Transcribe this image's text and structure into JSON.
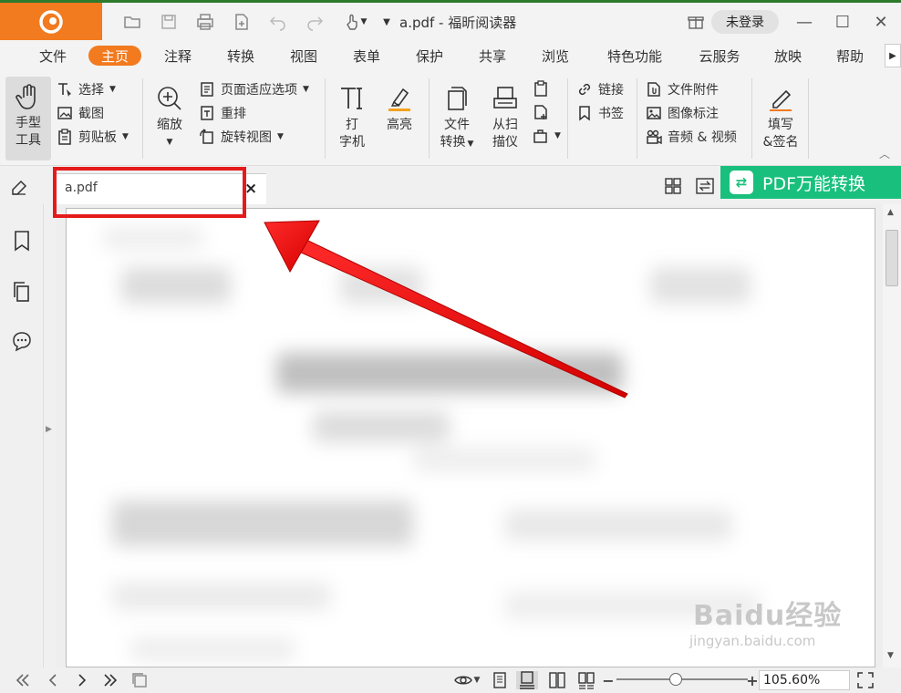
{
  "window": {
    "title": "a.pdf - 福昕阅读器",
    "login_label": "未登录"
  },
  "menu": {
    "items": [
      "文件",
      "主页",
      "注释",
      "转换",
      "视图",
      "表单",
      "保护",
      "共享",
      "浏览",
      "特色功能",
      "云服务",
      "放映",
      "帮助"
    ],
    "active_index": 1
  },
  "ribbon": {
    "hand_tool": [
      "手型",
      "工具"
    ],
    "select": "选择",
    "screenshot": "截图",
    "clipboard": "剪贴板",
    "zoom": "缩放",
    "page_fit": "页面适应选项",
    "reflow": "重排",
    "rotate": "旋转视图",
    "typewriter": [
      "打",
      "字机"
    ],
    "highlight": "高亮",
    "file_convert": [
      "文件",
      "转换"
    ],
    "scan": [
      "从扫",
      "描仪"
    ],
    "link": "链接",
    "bookmark": "书签",
    "attachment": "文件附件",
    "image_annot": "图像标注",
    "audio_video": "音频 & 视频",
    "fill_sign": [
      "填写",
      "&签名"
    ]
  },
  "document": {
    "tab_label": "a.pdf",
    "close_glyph": "×"
  },
  "banner": {
    "label": "PDF万能转换",
    "icon_glyph": "⇄"
  },
  "status": {
    "zoom_value": "105.60%",
    "zoom_level": 0.45,
    "zoom_minus": "−",
    "zoom_plus": "+"
  },
  "watermark": {
    "main": "Baidu经验",
    "sub": "jingyan.baidu.com"
  },
  "colors": {
    "accent": "#f27a1f",
    "banner": "#19c07d",
    "annotation": "#e51b1b"
  }
}
